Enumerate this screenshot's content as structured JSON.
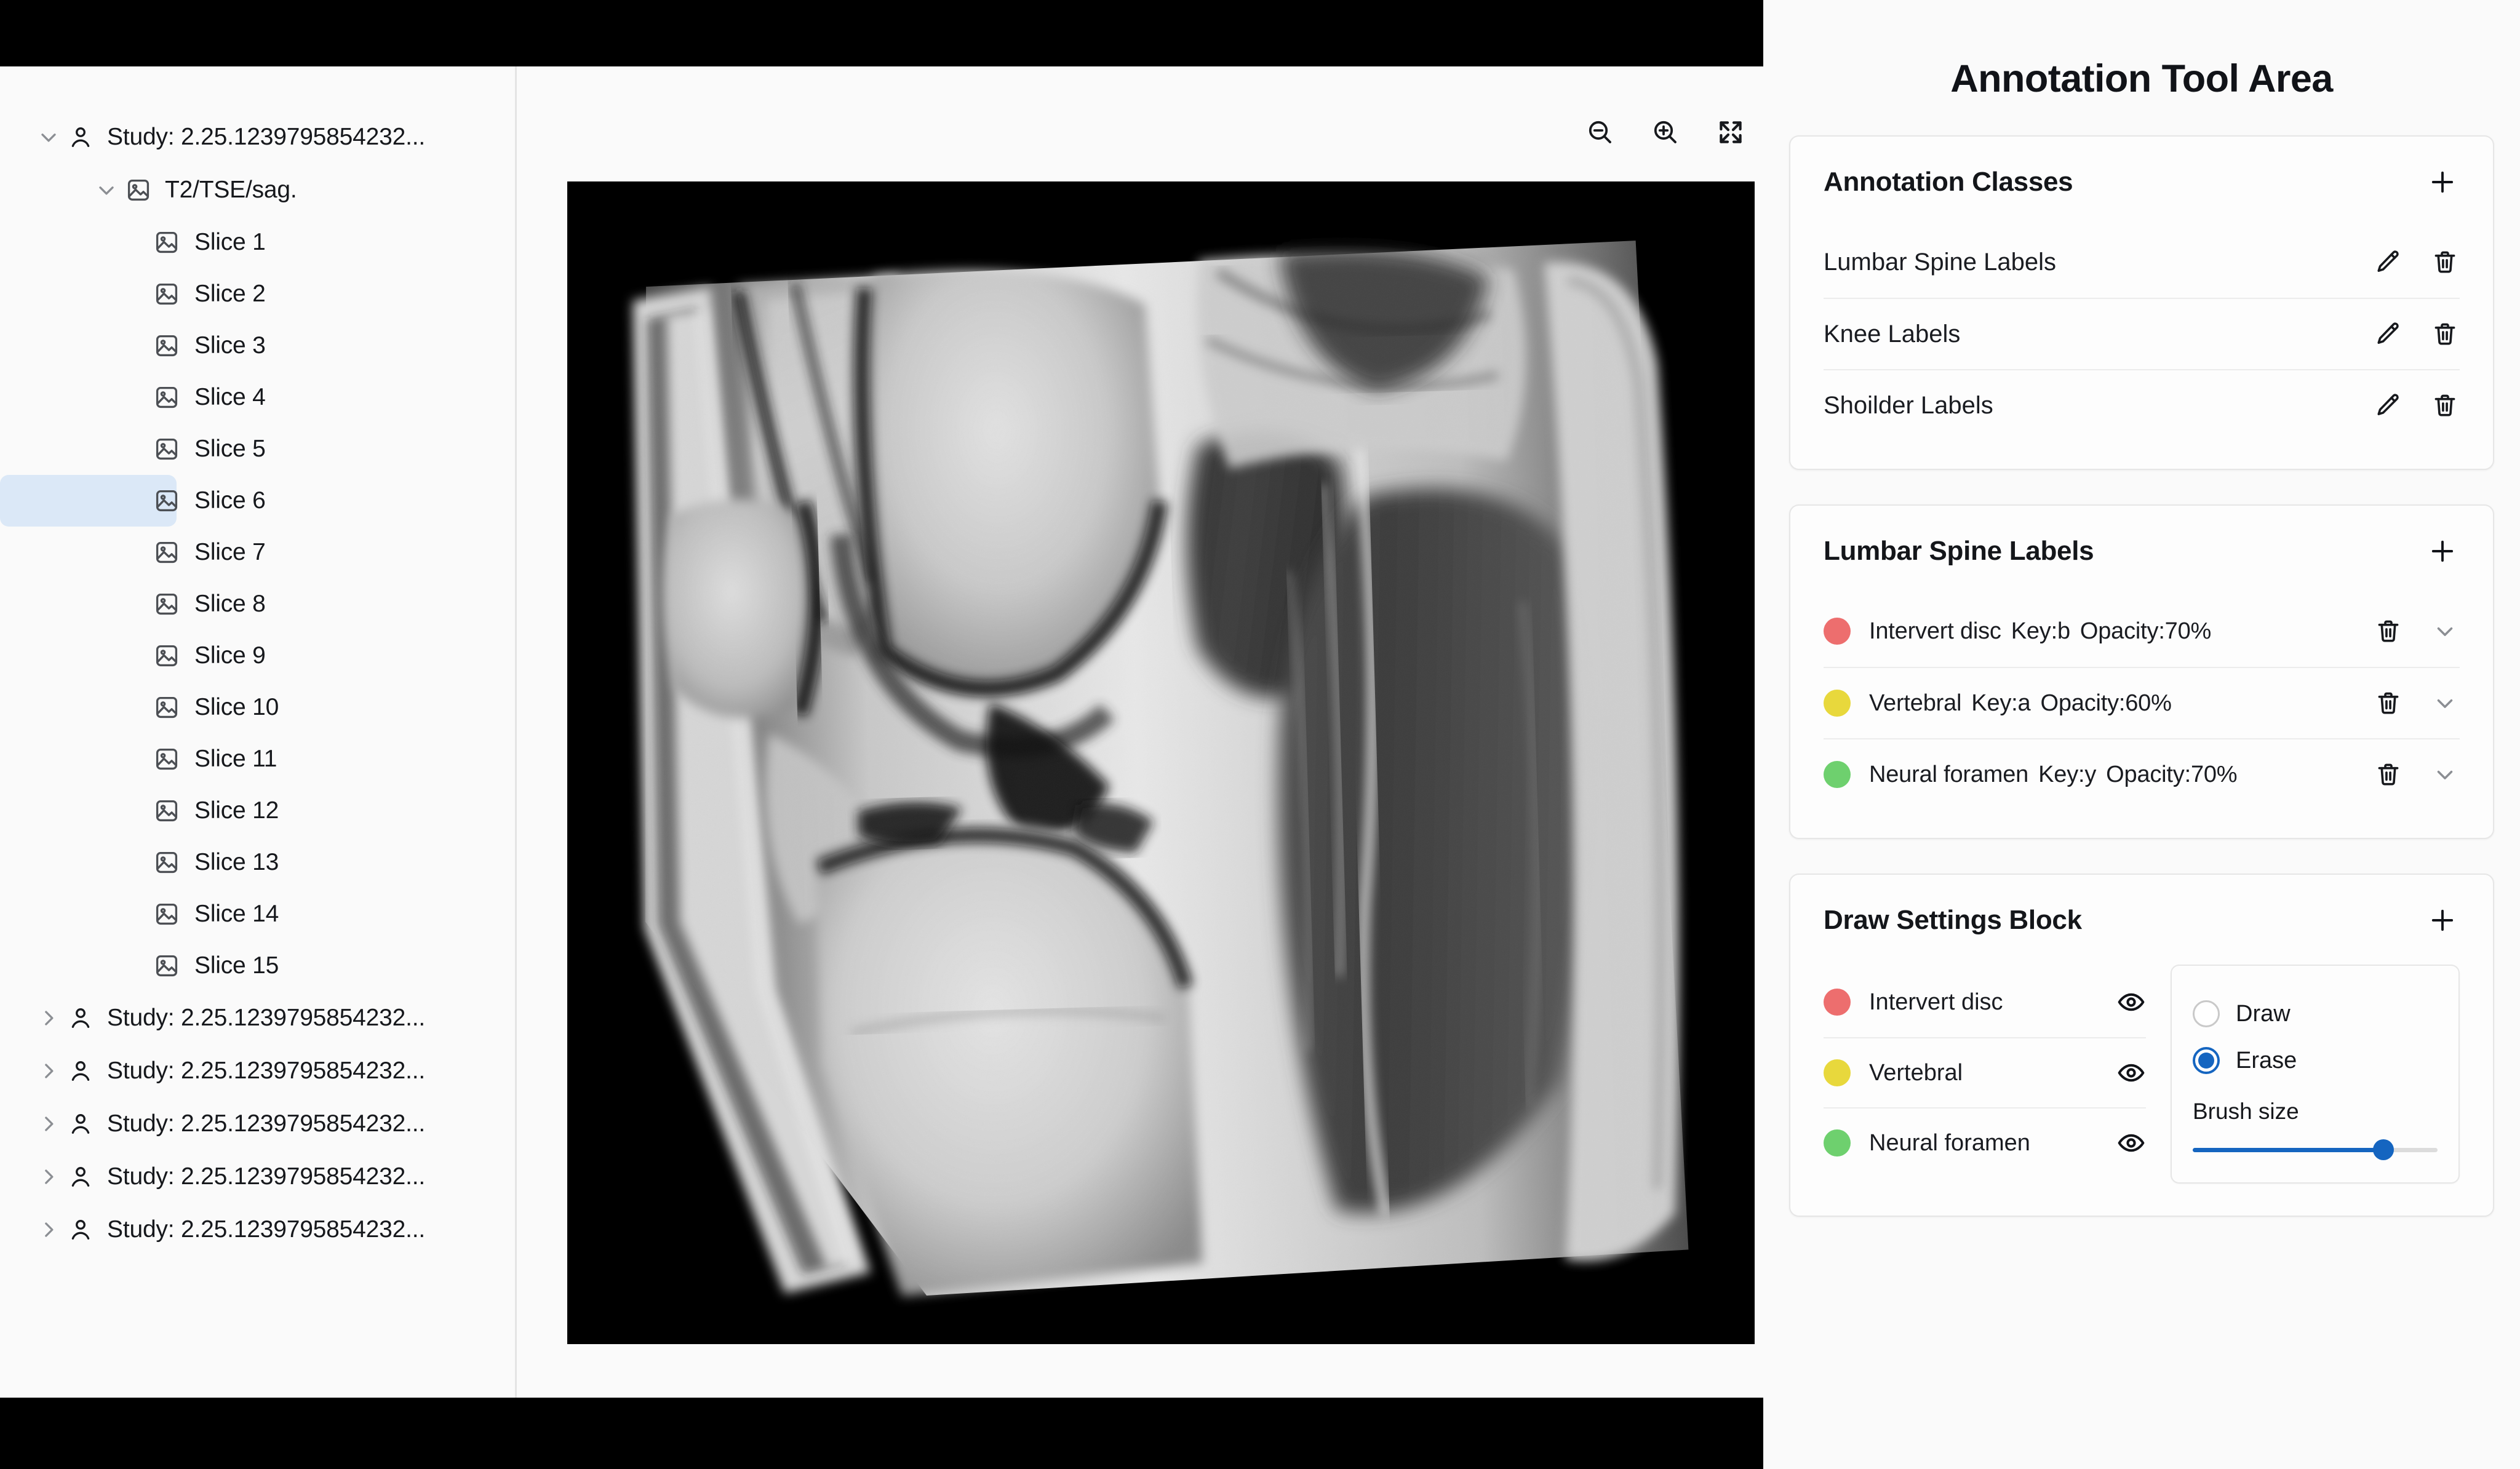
{
  "viewer": {
    "toolbar": [
      {
        "name": "zoom-out-icon",
        "label": "Zoom out"
      },
      {
        "name": "zoom-in-icon",
        "label": "Zoom in"
      },
      {
        "name": "fullscreen-icon",
        "label": "Fullscreen"
      }
    ]
  },
  "sidebar": {
    "studies": [
      {
        "label": "Study: 2.25.1239795854232...",
        "expanded": true,
        "series": [
          {
            "label": "T2/TSE/sag.",
            "expanded": true,
            "slices": [
              {
                "label": "Slice 1",
                "selected": false
              },
              {
                "label": "Slice 2",
                "selected": false
              },
              {
                "label": "Slice 3",
                "selected": false
              },
              {
                "label": "Slice 4",
                "selected": false
              },
              {
                "label": "Slice 5",
                "selected": false
              },
              {
                "label": "Slice 6",
                "selected": true
              },
              {
                "label": "Slice 7",
                "selected": false
              },
              {
                "label": "Slice 8",
                "selected": false
              },
              {
                "label": "Slice 9",
                "selected": false
              },
              {
                "label": "Slice 10",
                "selected": false
              },
              {
                "label": "Slice 11",
                "selected": false
              },
              {
                "label": "Slice 12",
                "selected": false
              },
              {
                "label": "Slice 13",
                "selected": false
              },
              {
                "label": "Slice 14",
                "selected": false
              },
              {
                "label": "Slice 15",
                "selected": false
              }
            ]
          }
        ]
      },
      {
        "label": "Study: 2.25.1239795854232...",
        "expanded": false,
        "series": []
      },
      {
        "label": "Study: 2.25.1239795854232...",
        "expanded": false,
        "series": []
      },
      {
        "label": "Study: 2.25.1239795854232...",
        "expanded": false,
        "series": []
      },
      {
        "label": "Study: 2.25.1239795854232...",
        "expanded": false,
        "series": []
      },
      {
        "label": "Study: 2.25.1239795854232...",
        "expanded": false,
        "series": []
      }
    ]
  },
  "tool_area": {
    "title": "Annotation Tool Area",
    "annotation_classes": {
      "title": "Annotation Classes",
      "add_label": "+",
      "items": [
        {
          "name": "Lumbar Spine Labels"
        },
        {
          "name": "Knee Labels"
        },
        {
          "name": "Shoilder Labels"
        }
      ]
    },
    "label_group": {
      "title": "Lumbar Spine Labels",
      "add_label": "+",
      "items": [
        {
          "name": "Intervert disc",
          "key": "Key:b",
          "opacity": "Opacity:70%",
          "color": "#ED6E6E"
        },
        {
          "name": "Vertebral",
          "key": "Key:a",
          "opacity": "Opacity:60%",
          "color": "#E8D83C"
        },
        {
          "name": "Neural foramen",
          "key": "Key:y",
          "opacity": "Opacity:70%",
          "color": "#6ED06E"
        }
      ]
    },
    "draw_settings": {
      "title": "Draw Settings Block",
      "add_label": "+",
      "visibility": [
        {
          "name": "Intervert disc",
          "color": "#ED6E6E"
        },
        {
          "name": "Vertebral",
          "color": "#E8D83C"
        },
        {
          "name": "Neural foramen",
          "color": "#6ED06E"
        }
      ],
      "modes": [
        {
          "label": "Draw",
          "selected": false
        },
        {
          "label": "Erase",
          "selected": true
        }
      ],
      "brush_size_label": "Brush size",
      "brush_size_percent": 78,
      "accent_color": "#1565C0"
    }
  }
}
